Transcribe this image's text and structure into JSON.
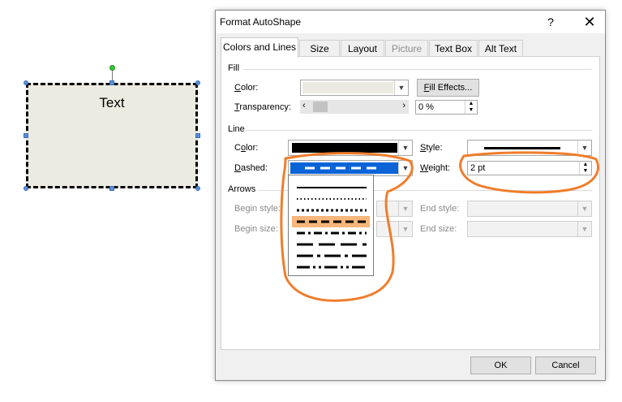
{
  "canvas": {
    "shape_text": "Text",
    "shape_fill": "#ecebe1"
  },
  "dialog": {
    "title": "Format AutoShape",
    "help_label": "?",
    "close_label": "✕",
    "tabs": [
      {
        "label": "Colors and Lines",
        "state": "active"
      },
      {
        "label": "Size",
        "state": "normal"
      },
      {
        "label": "Layout",
        "state": "normal"
      },
      {
        "label": "Picture",
        "state": "disabled"
      },
      {
        "label": "Text Box",
        "state": "normal"
      },
      {
        "label": "Alt Text",
        "state": "normal"
      }
    ],
    "fill": {
      "group_label": "Fill",
      "color_label_pre": "",
      "color_label_key": "C",
      "color_label_post": "olor:",
      "color_swatch": "#ecebe1",
      "fill_effects_key": "F",
      "fill_effects_rest": "ill Effects...",
      "transparency_label_key": "T",
      "transparency_label_rest": "ransparency:",
      "transparency_value": "0 %",
      "transparency_fraction": 0
    },
    "line": {
      "group_label": "Line",
      "color_label_pre": "C",
      "color_label_key": "o",
      "color_label_post": "lor:",
      "color_swatch": "#000000",
      "dashed_label_key": "D",
      "dashed_label_rest": "ashed:",
      "style_label_key": "S",
      "style_label_rest": "tyle:",
      "weight_label_key": "W",
      "weight_label_rest": "eight:",
      "weight_value": "2 pt"
    },
    "arrows": {
      "group_label": "Arrows",
      "begin_style_label": "Begin style:",
      "begin_size_label": "Begin size:",
      "end_style_label": "End style:",
      "end_size_label": "End size:"
    },
    "dash_options": [
      "solid",
      "round-dot",
      "square-dot",
      "dash",
      "dash-dot",
      "long-dash",
      "long-dash-dot",
      "long-dash-dot-dot"
    ],
    "selected_dash": "dash",
    "ok_label": "OK",
    "cancel_label": "Cancel"
  },
  "colors": {
    "annotation": "#f07d2a",
    "selection_highlight": "#f8b67a",
    "selected_blue": "#0a64d8"
  }
}
